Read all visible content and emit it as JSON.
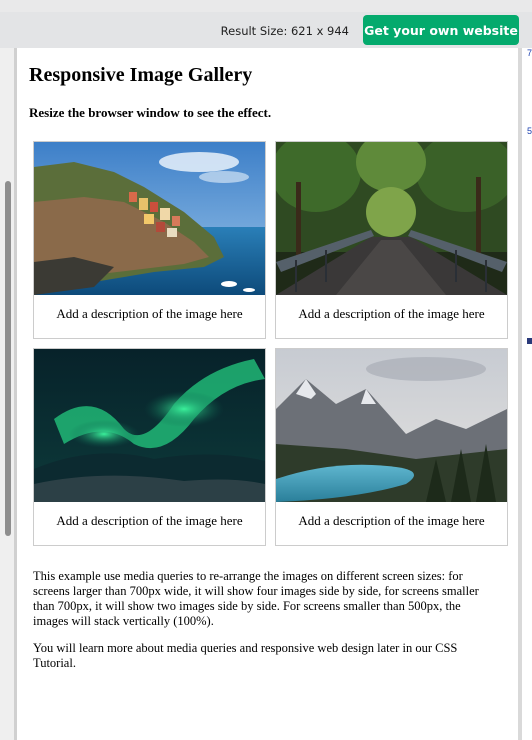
{
  "toolbar": {
    "result_size": "Result Size: 621 x 944",
    "get_button": "Get your own website"
  },
  "page": {
    "title": "Responsive Image Gallery",
    "subtitle": "Resize the browser window to see the effect."
  },
  "gallery": [
    {
      "image": "cinque-terre-coastal-village",
      "description": "Add a description of the image here"
    },
    {
      "image": "forest-footbridge",
      "description": "Add a description of the image here"
    },
    {
      "image": "northern-lights",
      "description": "Add a description of the image here"
    },
    {
      "image": "mountain-lake",
      "description": "Add a description of the image here"
    }
  ],
  "paragraphs": {
    "p1": "This example use media queries to re-arrange the images on different screen sizes: for screens larger than 700px wide, it will show four images side by side, for screens smaller than 700px, it will show two images side by side. For screens smaller than 500px, the images will stack vertically (100%).",
    "p2": "You will learn more about media queries and responsive web design later in our CSS Tutorial."
  },
  "colors": {
    "button_green": "#04aa6d",
    "toolbar_bg": "#e3e4e6"
  }
}
